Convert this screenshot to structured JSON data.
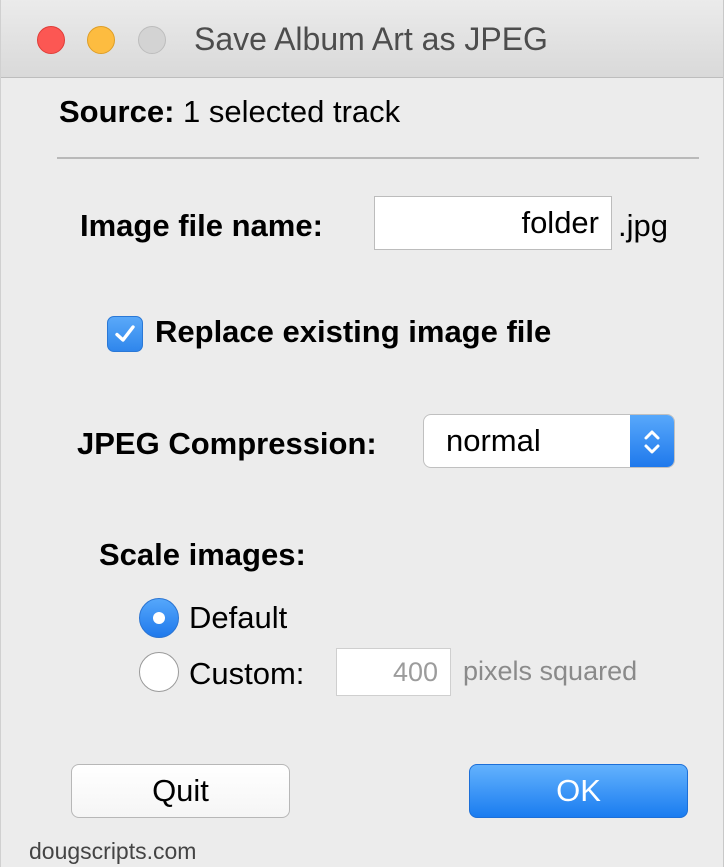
{
  "window": {
    "title": "Save Album Art as JPEG"
  },
  "source": {
    "label": "Source:",
    "value": "1 selected track"
  },
  "filename": {
    "label": "Image file name:",
    "value": "folder",
    "extension": ".jpg"
  },
  "replace": {
    "label": "Replace existing image file",
    "checked": true
  },
  "compression": {
    "label": "JPEG Compression:",
    "selected": "normal"
  },
  "scale": {
    "label": "Scale images:",
    "options": [
      {
        "label": "Default",
        "selected": true
      },
      {
        "label": "Custom:",
        "selected": false
      }
    ],
    "custom_value": "400",
    "custom_unit": "pixels squared"
  },
  "buttons": {
    "quit": "Quit",
    "ok": "OK"
  },
  "footer": "dougscripts.com",
  "colors": {
    "accent": "#2f86ec",
    "close": "#fc5753",
    "minimize": "#fdbc40",
    "zoom_disabled": "#d3d3d3"
  }
}
